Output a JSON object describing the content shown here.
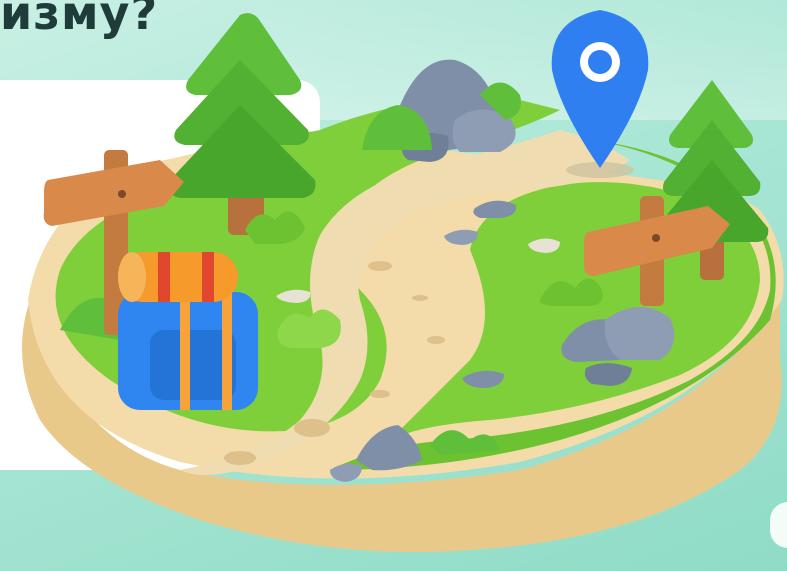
{
  "header": {
    "title_fragment": "изму?"
  },
  "scene": {
    "icons": [
      "tree-icon",
      "signpost-icon",
      "location-pin-icon",
      "backpack-icon",
      "rock-icon",
      "bush-icon"
    ],
    "colors": {
      "background": "#a9e6d5",
      "grass": "#7fcf3a",
      "path": "#efdcb0",
      "base": "#f1d9a6",
      "pin": "#2f7ff0",
      "backpack": "#2f86f0",
      "bedroll": "#f59a2b",
      "wood": "#d98a4a",
      "rock": "#7f8fa8"
    }
  }
}
